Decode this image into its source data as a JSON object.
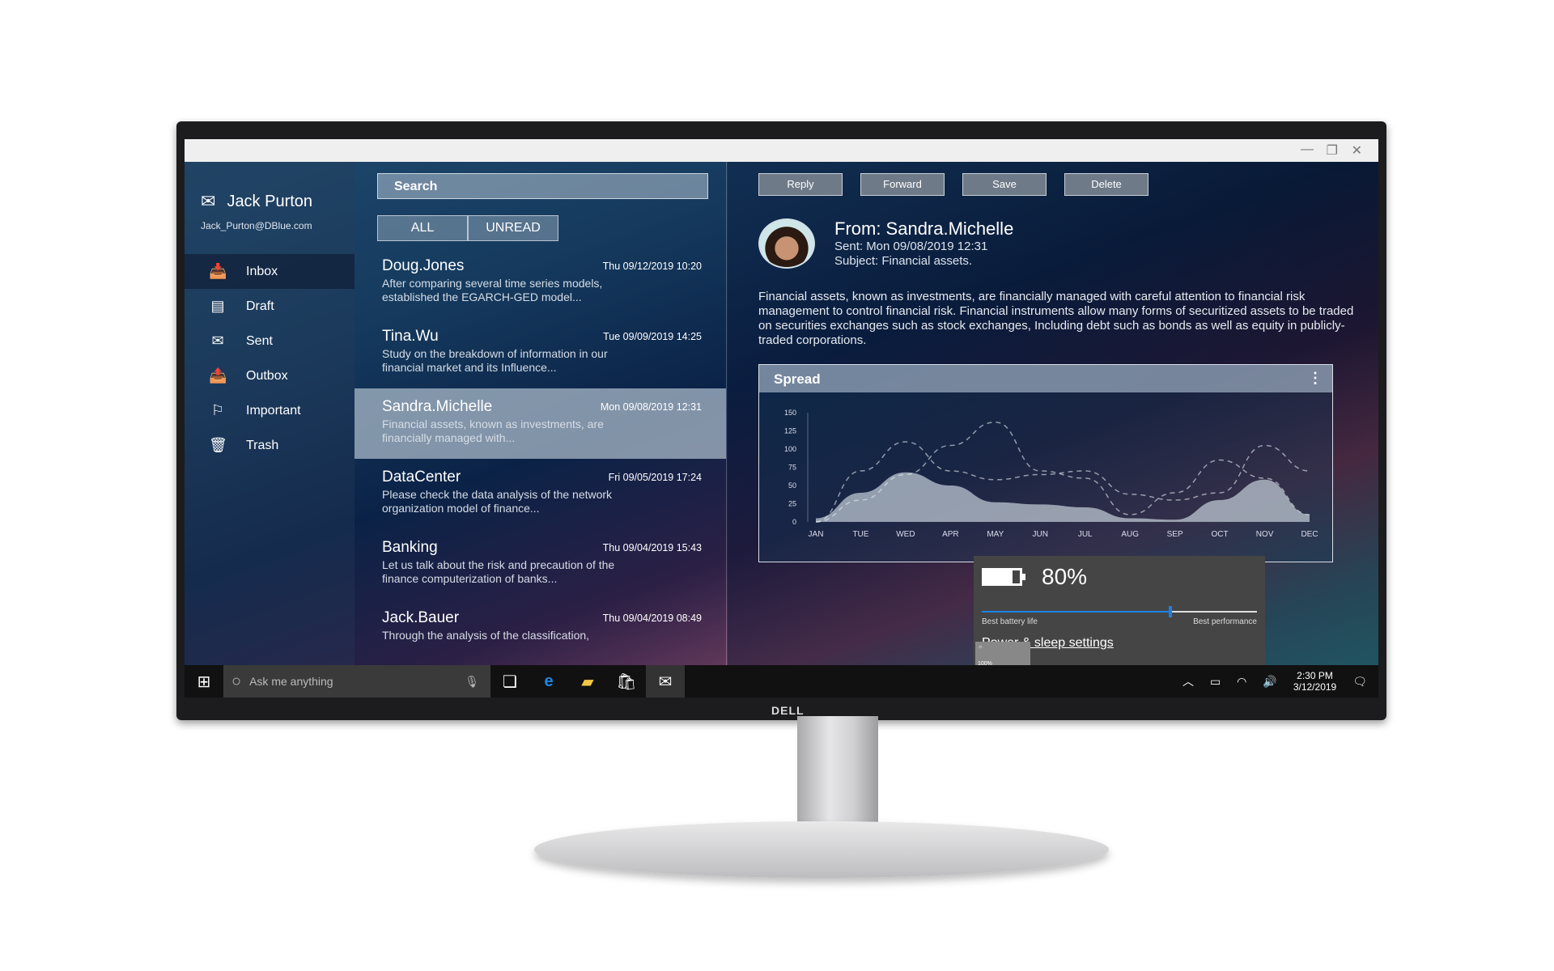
{
  "window": {
    "minimize": "—",
    "restore": "❐",
    "close": "✕"
  },
  "account": {
    "name": "Jack Purton",
    "email": "Jack_Purton@DBlue.com"
  },
  "sidebar": {
    "items": [
      {
        "label": "Inbox",
        "icon": "inbox-icon",
        "glyph": "📥"
      },
      {
        "label": "Draft",
        "icon": "draft-icon",
        "glyph": "▤"
      },
      {
        "label": "Sent",
        "icon": "sent-icon",
        "glyph": "✉"
      },
      {
        "label": "Outbox",
        "icon": "outbox-icon",
        "glyph": "📤"
      },
      {
        "label": "Important",
        "icon": "flag-icon",
        "glyph": "⚐"
      },
      {
        "label": "Trash",
        "icon": "trash-icon",
        "glyph": "🗑"
      }
    ]
  },
  "list": {
    "search_placeholder": "Search",
    "filters": [
      "ALL",
      "UNREAD"
    ],
    "mails": [
      {
        "from": "Doug.Jones",
        "date": "Thu 09/12/2019 10:20",
        "preview": "After comparing several time series models, established the EGARCH-GED model..."
      },
      {
        "from": "Tina.Wu",
        "date": "Tue 09/09/2019 14:25",
        "preview": "Study on the breakdown of information in our financial market and its Influence..."
      },
      {
        "from": "Sandra.Michelle",
        "date": "Mon 09/08/2019 12:31",
        "preview": "Financial assets, known as investments, are financially managed with..."
      },
      {
        "from": "DataCenter",
        "date": "Fri 09/05/2019 17:24",
        "preview": "Please check the data analysis of the network organization model of finance..."
      },
      {
        "from": "Banking",
        "date": "Thu 09/04/2019 15:43",
        "preview": "Let us talk about the risk and precaution of the finance computerization of banks..."
      },
      {
        "from": "Jack.Bauer",
        "date": "Thu 09/04/2019 08:49",
        "preview": "Through the analysis of the classification,"
      }
    ]
  },
  "reader": {
    "actions": [
      "Reply",
      "Forward",
      "Save",
      "Delete"
    ],
    "from": "From: Sandra.Michelle",
    "sent": "Sent: Mon 09/08/2019 12:31",
    "subject": "Subject: Financial assets.",
    "body": "Financial assets, known as investments, are financially managed with careful attention to financial risk management to control financial risk. Financial instruments allow many forms of securitized assets to be traded on securities exchanges such as stock exchanges, Including debt such as bonds as well as equity in publicly-traded corporations."
  },
  "chart_data": {
    "type": "area",
    "title": "Spread",
    "ylim": [
      0,
      150
    ],
    "yticks": [
      0,
      25,
      50,
      75,
      100,
      125,
      150
    ],
    "grid": false,
    "categories": [
      "JAN",
      "TUE",
      "WED",
      "APR",
      "MAY",
      "JUN",
      "JUL",
      "AUG",
      "SEP",
      "OCT",
      "NOV",
      "DEC"
    ],
    "series": [
      {
        "style": "filled",
        "values": [
          5,
          40,
          68,
          50,
          27,
          24,
          20,
          5,
          3,
          30,
          58,
          10
        ]
      },
      {
        "style": "dashed",
        "values": [
          0,
          70,
          110,
          70,
          58,
          65,
          70,
          38,
          30,
          40,
          105,
          70
        ]
      },
      {
        "style": "dashed",
        "values": [
          0,
          30,
          65,
          105,
          137,
          70,
          60,
          10,
          40,
          85,
          60,
          10
        ]
      }
    ]
  },
  "battery": {
    "percent": "80%",
    "level": 0.8,
    "mode_value": 0.68,
    "left_label": "Best battery life",
    "right_label": "Best performance",
    "link": "Power & sleep settings",
    "brightness": "100%"
  },
  "taskbar": {
    "search_placeholder": "Ask me anything",
    "time": "2:30 PM",
    "date": "3/12/2019"
  },
  "brand": "DELL",
  "colors": {
    "accent": "#1a82e6",
    "taskbar": "#111111",
    "flyout": "#454545"
  }
}
